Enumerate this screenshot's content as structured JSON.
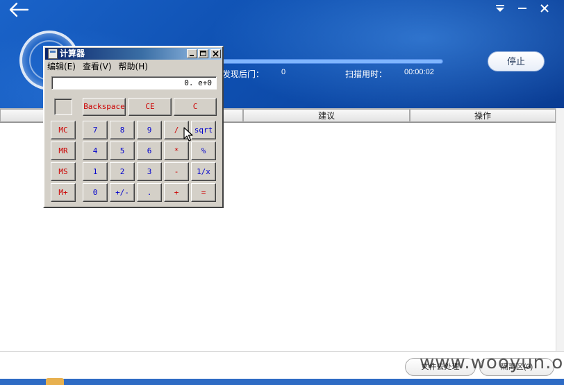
{
  "header": {
    "scan_stats": {
      "backdoor_label": "发现后门：",
      "backdoor_value": "0",
      "scantime_label": "扫描用时：",
      "scantime_value": "00:00:02"
    },
    "stop_label": "停止",
    "progress_fraction": 1.0
  },
  "results_table": {
    "columns": [
      "",
      "建议",
      "操作"
    ]
  },
  "footer": {
    "button_1_label": "文件去处理",
    "button_2_label": "隔离区(0)"
  },
  "watermark": "www.wooyun.org",
  "calculator": {
    "title": "计算器",
    "menu": [
      "编辑(E)",
      "查看(V)",
      "帮助(H)"
    ],
    "display_value": "0. e+0",
    "top_buttons": [
      "Backspace",
      "CE",
      "C"
    ],
    "memory_buttons": [
      "MC",
      "MR",
      "MS",
      "M+"
    ],
    "rows": [
      [
        "7",
        "8",
        "9",
        "/",
        "sqrt"
      ],
      [
        "4",
        "5",
        "6",
        "*",
        "%"
      ],
      [
        "1",
        "2",
        "3",
        "-",
        "1/x"
      ],
      [
        "0",
        "+/-",
        ".",
        "+",
        "="
      ]
    ]
  },
  "colors": {
    "header_blue": "#0e4fb0",
    "calc_face": "#d4d0c8",
    "digit_blue": "#0000cc",
    "operator_red": "#cc0000",
    "titlebar_navy": "#0a246a"
  },
  "icons": [
    "back-arrow-icon",
    "dropdown-icon",
    "close-icon",
    "calculator-icon",
    "mouse-cursor-icon"
  ]
}
